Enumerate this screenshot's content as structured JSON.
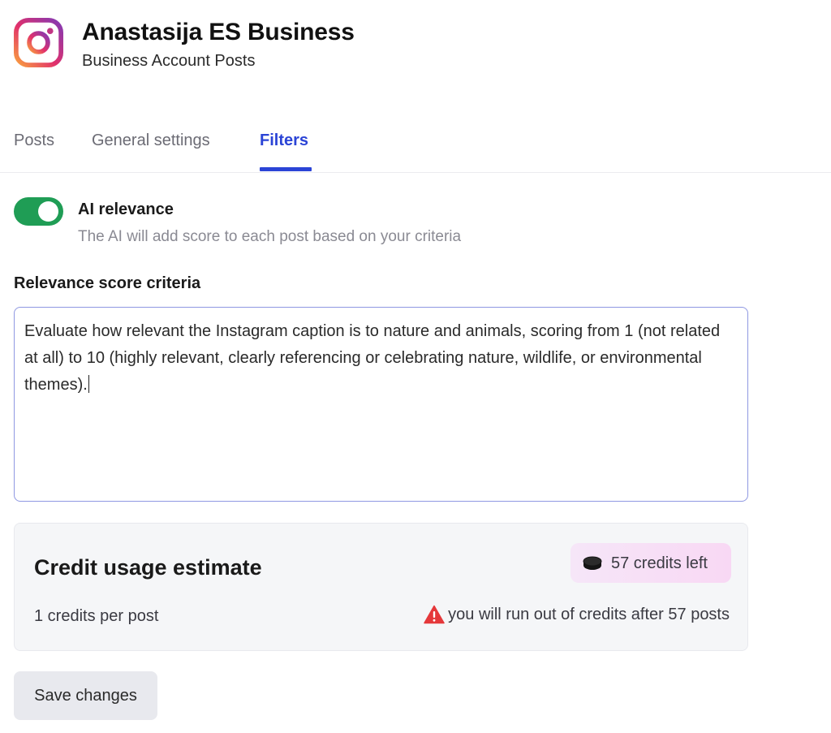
{
  "header": {
    "title": "Anastasija ES Business",
    "subtitle": "Business Account Posts",
    "logo_icon": "instagram-icon"
  },
  "tabs": [
    {
      "label": "Posts",
      "active": false
    },
    {
      "label": "General settings",
      "active": false
    },
    {
      "label": "Filters",
      "active": true
    }
  ],
  "ai_relevance": {
    "enabled": true,
    "label": "AI relevance",
    "description": "The AI will add score to each post based on your criteria"
  },
  "criteria": {
    "label": "Relevance score criteria",
    "value": "Evaluate how relevant the Instagram caption is to nature and animals, scoring from 1 (not related at all) to 10 (highly relevant, clearly referencing or celebrating nature, wildlife, or environmental themes)."
  },
  "credit_usage": {
    "title": "Credit usage estimate",
    "credits_left": "57 credits left",
    "per_post": "1 credits per post",
    "warning": "you will run out of credits after 57 posts",
    "coin_icon": "coin-icon",
    "warning_icon": "warning-icon"
  },
  "actions": {
    "save_label": "Save changes"
  },
  "colors": {
    "accent": "#2b44d6",
    "toggle_on": "#1f9d55",
    "warning": "#e5383b",
    "badge_background": "#f7def5"
  }
}
